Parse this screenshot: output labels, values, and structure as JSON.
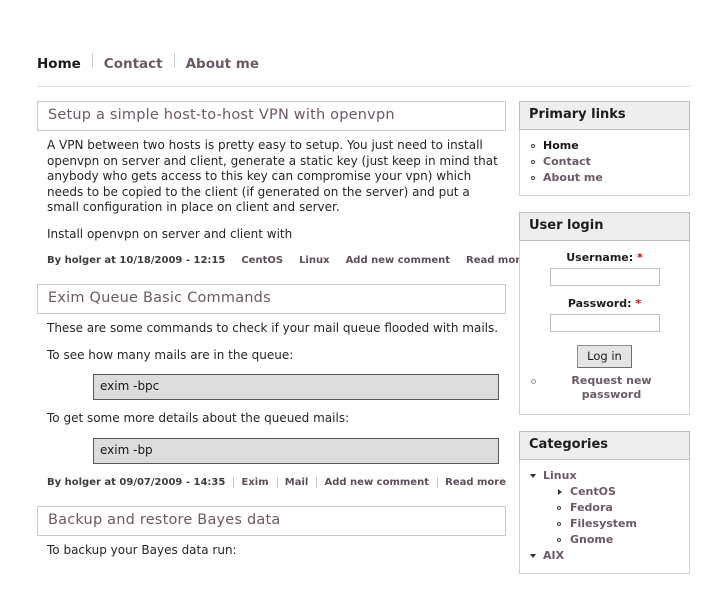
{
  "nav": {
    "items": [
      {
        "label": "Home",
        "current": true
      },
      {
        "label": "Contact",
        "current": false
      },
      {
        "label": "About me",
        "current": false
      }
    ]
  },
  "content": {
    "nodes": [
      {
        "title": "Setup a simple host-to-host VPN with openvpn",
        "paragraphs": [
          "A VPN between two hosts is pretty easy to setup. You just need to install openvpn on server and client, generate a static key (just keep in mind that anybody who gets access to this key can compromise your vpn) which needs to be copied to the client (if generated on the server) and put a small configuration in place on client and server.",
          "Install openvpn on server and client with"
        ],
        "meta": {
          "byline": "By holger at 10/18/2009 - 12:15",
          "links": [
            "CentOS",
            "Linux",
            "Add new comment",
            "Read more"
          ]
        }
      },
      {
        "title": "Exim Queue Basic Commands",
        "intro": "These are some commands to check if your mail queue flooded with mails.",
        "line1": "To see how many mails are in the queue:",
        "code1": "exim -bpc",
        "line2": "To get some more details about the queued mails:",
        "code2": "exim -bp",
        "meta": {
          "byline": "By holger at 09/07/2009 - 14:35",
          "links": [
            "Exim",
            "Mail",
            "Add new comment",
            "Read more"
          ]
        }
      },
      {
        "title": "Backup and restore Bayes data",
        "cut_off_text": "To backup your Bayes data run:"
      }
    ]
  },
  "sidebar": {
    "primary_links": {
      "title": "Primary links",
      "items": [
        {
          "label": "Home",
          "current": true
        },
        {
          "label": "Contact",
          "current": false
        },
        {
          "label": "About me",
          "current": false
        }
      ]
    },
    "user_login": {
      "title": "User login",
      "username_label": "Username:",
      "username_value": "",
      "password_label": "Password:",
      "password_value": "",
      "required_marker": "*",
      "submit_label": "Log in",
      "request_password_label": "Request new password"
    },
    "categories": {
      "title": "Categories",
      "items": [
        {
          "label": "Linux",
          "icon": "triangle-down",
          "children": [
            {
              "label": "CentOS",
              "icon": "triangle-right"
            },
            {
              "label": "Fedora",
              "icon": "ring"
            },
            {
              "label": "Filesystem",
              "icon": "ring"
            },
            {
              "label": "Gnome",
              "icon": "ring"
            }
          ]
        },
        {
          "label": "AIX",
          "icon": "triangle-down",
          "children": []
        }
      ]
    }
  }
}
